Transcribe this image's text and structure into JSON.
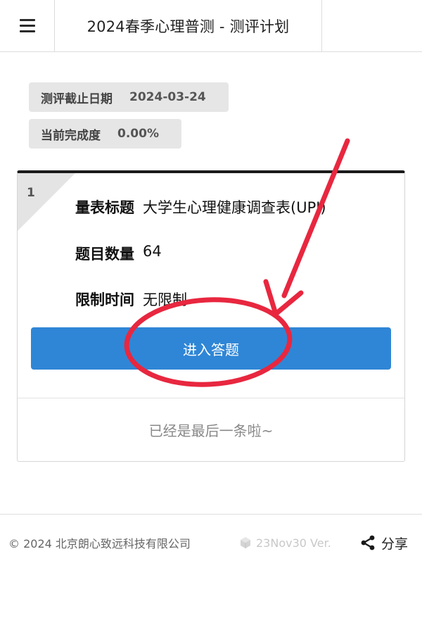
{
  "header": {
    "menu_icon": "hamburger-menu-icon",
    "title": "2024春季心理普测 - 测评计划"
  },
  "info": {
    "deadline_label": "测评截止日期",
    "deadline_value": "2024-03-24",
    "progress_label": "当前完成度",
    "progress_value": "0.00%"
  },
  "card": {
    "index": "1",
    "scale_label": "量表标题",
    "scale_value": "大学生心理健康调查表(UPI)",
    "count_label": "题目数量",
    "count_value": "64",
    "limit_label": "限制时间",
    "limit_value": "无限制",
    "enter_button": "进入答题",
    "end_text": "已经是最后一条啦~"
  },
  "footer": {
    "copyright": "© 2024 北京朗心致远科技有限公司",
    "version": "23Nov30 Ver.",
    "version_icon": "cube-icon",
    "share_label": "分享",
    "share_icon": "share-icon"
  },
  "annotation": {
    "color": "#e8273f"
  }
}
